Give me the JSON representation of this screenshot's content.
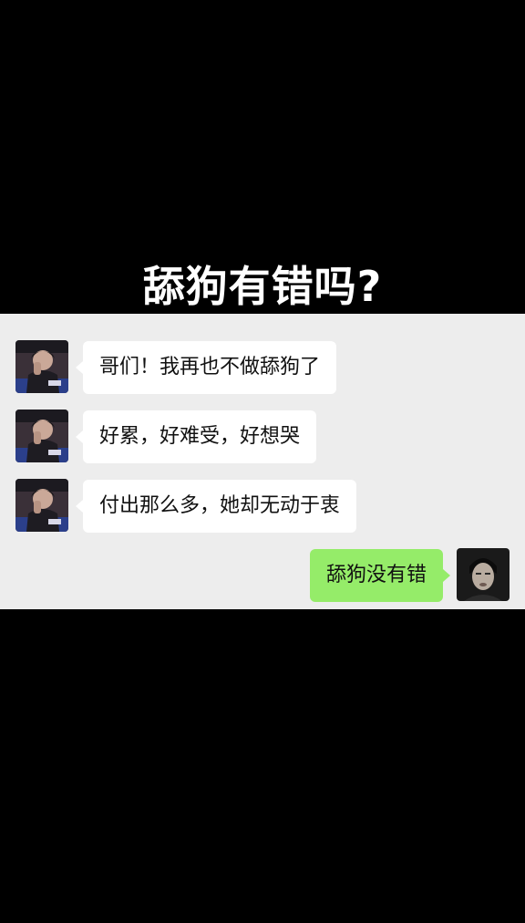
{
  "title": "舔狗有错吗?",
  "messages": [
    {
      "side": "left",
      "text": "哥们！我再也不做舔狗了",
      "avatar": "friend-avatar"
    },
    {
      "side": "left",
      "text": "好累，好难受，好想哭",
      "avatar": "friend-avatar"
    },
    {
      "side": "left",
      "text": "付出那么多，她却无动于衷",
      "avatar": "friend-avatar"
    },
    {
      "side": "right",
      "text": "舔狗没有错",
      "avatar": "self-avatar"
    }
  ],
  "colors": {
    "chat_background": "#ededed",
    "incoming_bubble": "#ffffff",
    "outgoing_bubble": "#95ec69",
    "letterbox": "#000000"
  }
}
